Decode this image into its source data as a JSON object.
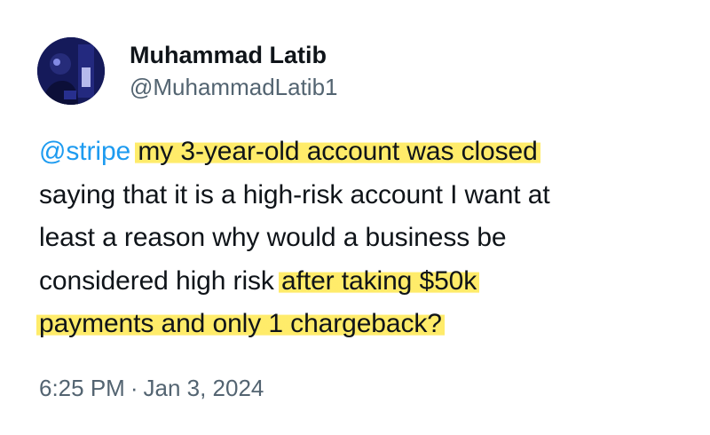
{
  "author": {
    "display_name": "Muhammad Latib",
    "handle": "@MuhammadLatib1"
  },
  "tweet": {
    "mention": "@stripe",
    "line1_highlight": "my 3-year-old account was closed",
    "line2": "saying that it is a high-risk account I want at",
    "line3": "least a reason why would a business be",
    "line4_plain": "considered high risk ",
    "line4_highlight": "after taking $50k",
    "line5_highlight": "payments and only 1 chargeback?"
  },
  "meta": {
    "time": "6:25 PM",
    "separator": "·",
    "date": "Jan 3, 2024"
  },
  "colors": {
    "mention": "#1d9bf0",
    "highlight": "#ffe850",
    "secondary_text": "#536471",
    "primary_text": "#0f1419"
  },
  "icons": {
    "avatar": "profile-photo"
  }
}
